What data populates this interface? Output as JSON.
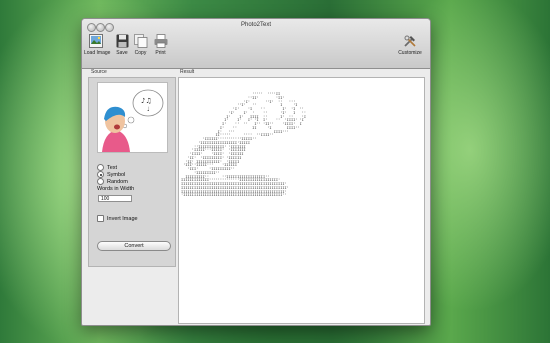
{
  "window": {
    "title": "Photo2Text"
  },
  "toolbar": {
    "load_image": "Load Image",
    "save": "Save",
    "copy": "Copy",
    "print": "Print",
    "customize": "Customize"
  },
  "source": {
    "label": "Source",
    "mode_options": [
      {
        "label": "Text",
        "selected": false
      },
      {
        "label": "Symbol",
        "selected": true
      },
      {
        "label": "Random",
        "selected": false
      }
    ],
    "words_in_width_label": "Words in Width",
    "words_in_width_value": "100",
    "invert_image_label": "Invert Image",
    "invert_image_checked": false,
    "convert_button": "Convert"
  },
  "result": {
    "label": "Result",
    "ascii_art": "                                 '''''  ''''II\n                               ''II'        'II'\n                             'I'       ''I'  ''   '''\n                          ''I'   ''           I     'I\n                        'I'    'I    ''        I'  'I  ''\n                      'I'    I'  '    ''      'I'   I   ''\n                     I'    I'   IIII  ''      I'  ''    'I\n                    I'    I'   I' 'I  I'    ''  'IIII' 'I\n                   I'    ''  ''   I'' 'II''    'IIII'  I\n                  I'    ''       II     'I       IIII''\n                 I'   '''                  IIII'''\n                II'''''      ''''  ''IIII''\n          'IIIIII'''''''''''IIIII''\n        'IIIIIIIIIIIIIIIII'IIIII\n      ''IIIIIIIIIIII' 'IIIIIII\n     'IIIII'''IIIII'  'IIIIIII\n    'IIII'    'IIII'  'IIIIII\n   'II'  'IIIIIIIII' 'IIIIII\n  'II' IIIIIIIIIII'  'IIIII\n 'III''IIIII'''    'IIIIII\n   'III'     'IIIIIIIII''\n      'IIIIIIIII''\n  IIIIIIIII''      ''IIIIIIIIIIIIIIIIII''\nIIIIIIIIIIIII''''''''''''''IIIIIIIIIIIIIIIIII'\nIIIIIIIIIIIIIIIIIIIIIIIIIIIIIIIIIIIIIIIIIIIIIIII'\nIIIIIIIIIIIIIIIIIIIIIIIIIIIIIIIIIIIIIIIIIIIIIIIII'\nIIIIIIIIIIIIIIIIIIIIIIIIIIIIIIIIIIIIIIIIIIIIIIII'\n'IIIIIIIIIIIIIIIIIIIIIIIIIIIIIIIIIIIIIIIIIIIIII''"
  },
  "colors": {
    "window_bg": "#ececec",
    "panel_bg": "#d5d5d5",
    "result_bg": "#ffffff"
  }
}
